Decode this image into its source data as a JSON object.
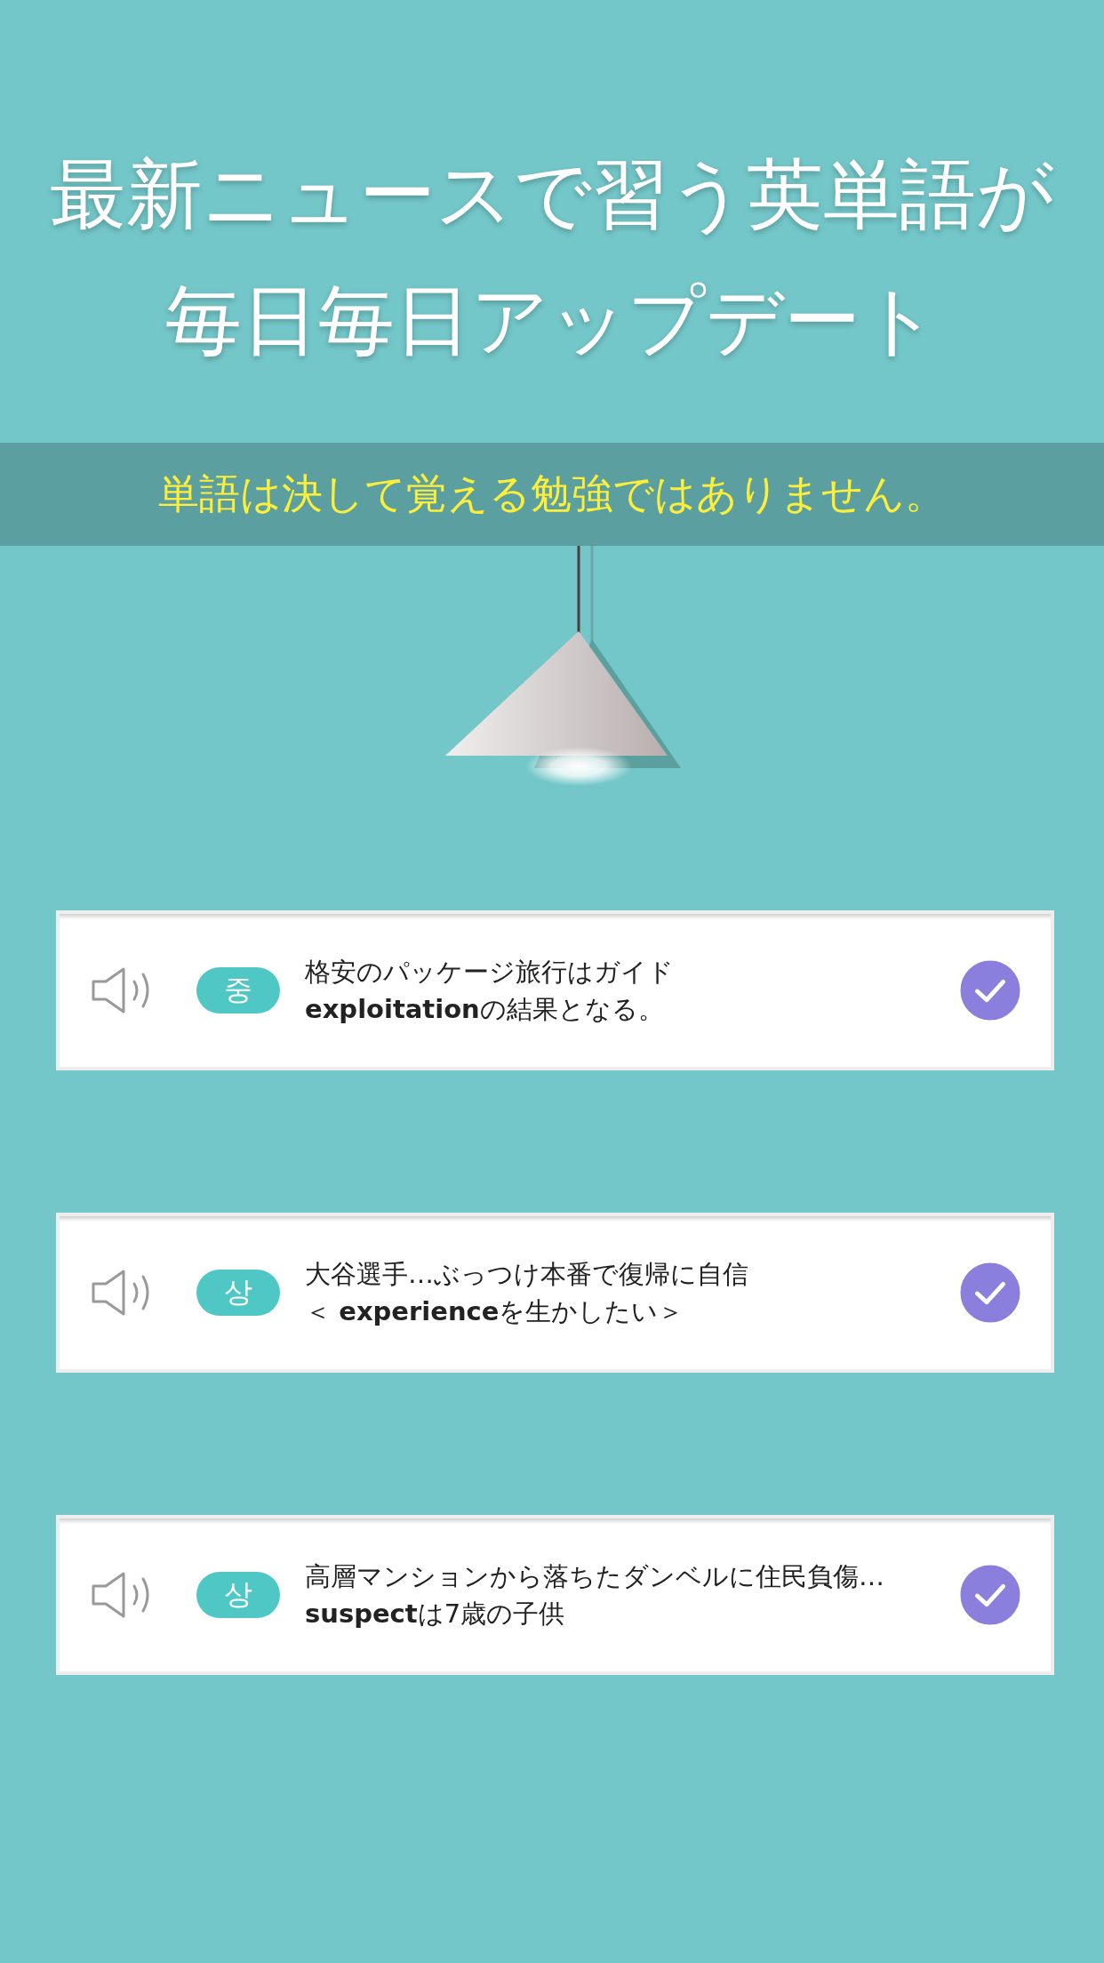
{
  "headline": [
    "最新ニュースで習う英単語が",
    "毎日毎日アップデート"
  ],
  "banner": "単語は決して覚える勉強ではありません。",
  "cards": [
    {
      "badge": "중",
      "lines": [
        "格安のパッケージ旅行はガイド",
        "**exploitation**の結果となる。"
      ],
      "checked": true
    },
    {
      "badge": "상",
      "lines": [
        "大谷選手…ぶっつけ本番で復帰に自信",
        "＜ **experience**を生かしたい＞"
      ],
      "checked": true
    },
    {
      "badge": "상",
      "lines": [
        "高層マンションから落ちたダンベルに住民負傷…",
        "**suspect**は7歳の子供"
      ],
      "checked": true
    }
  ]
}
